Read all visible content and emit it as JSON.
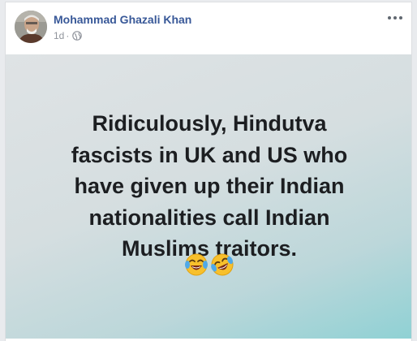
{
  "post": {
    "author": "Mohammad Ghazali Khan",
    "time": "1d",
    "separator": "·",
    "privacy_icon": "globe-icon",
    "more_icon": "more-options-icon",
    "lines": [
      "Ridiculously, Hindutva",
      "fascists in UK and US who",
      "have given up their Indian",
      "nationalities call Indian",
      "Muslims traitors."
    ],
    "emojis": [
      "face-with-tears-of-joy-icon",
      "rolling-on-the-floor-laughing-icon"
    ]
  },
  "colors": {
    "author": "#385898",
    "meta": "#90949c",
    "text": "#1c1e21",
    "gradient_end": "#8fd1d4"
  }
}
